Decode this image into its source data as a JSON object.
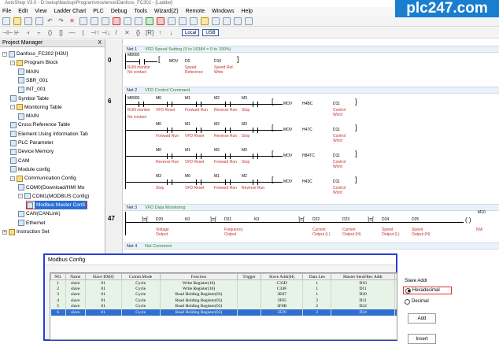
{
  "window": {
    "title": "AutoShop V3.0 - D:\\setup\\backup\\Program\\movience\\Danfoss_FC302 - [Ladder]"
  },
  "watermark": "plc247.com",
  "menu": [
    "File",
    "Edit",
    "View",
    "Ladder Chart",
    "PLC",
    "Debug",
    "Tools",
    "Wizard(Z)",
    "Remote",
    "Windows",
    "Help"
  ],
  "toolbar": {
    "local": "Local",
    "usb": "USB"
  },
  "project": {
    "header": "Project Manager",
    "close": "X",
    "pin": "❒",
    "items": [
      {
        "label": "Danfoss_FC302 [H3U]",
        "indent": 0,
        "box": "-",
        "icon": "plc-icon"
      },
      {
        "label": "Program Block",
        "indent": 1,
        "box": "-",
        "icon": "folder-icon"
      },
      {
        "label": "MAIN",
        "indent": 2,
        "box": "",
        "icon": "program-icon"
      },
      {
        "label": "SBR_001",
        "indent": 2,
        "box": "",
        "icon": "program-icon"
      },
      {
        "label": "INT_001",
        "indent": 2,
        "box": "",
        "icon": "program-icon"
      },
      {
        "label": "Symbol Table",
        "indent": 1,
        "box": "",
        "icon": "table-icon"
      },
      {
        "label": "Monitoring Table",
        "indent": 1,
        "box": "-",
        "icon": "folder-icon"
      },
      {
        "label": "MAIN",
        "indent": 2,
        "box": "",
        "icon": "table-icon"
      },
      {
        "label": "Cross Reference Table",
        "indent": 1,
        "box": "",
        "icon": "table-icon"
      },
      {
        "label": "Element Using Information Tab",
        "indent": 1,
        "box": "",
        "icon": "table-icon"
      },
      {
        "label": "PLC Parameter",
        "indent": 1,
        "box": "",
        "icon": "gear-icon"
      },
      {
        "label": "Device Memory",
        "indent": 1,
        "box": "",
        "icon": "memory-icon"
      },
      {
        "label": "CAM",
        "indent": 1,
        "box": "",
        "icon": "cam-icon"
      },
      {
        "label": "Module config",
        "indent": 1,
        "box": "",
        "icon": "module-icon"
      },
      {
        "label": "Communication Config",
        "indent": 1,
        "box": "-",
        "icon": "folder-icon"
      },
      {
        "label": "COM0(Download/HMI Mo",
        "indent": 2,
        "box": "",
        "icon": "port-icon"
      },
      {
        "label": "COM1(MODBUS Config)",
        "indent": 2,
        "box": "-",
        "icon": "port-icon"
      },
      {
        "label": "Modbus Master Confi",
        "indent": 3,
        "box": "",
        "icon": "modbus-icon",
        "selected": true
      },
      {
        "label": "CAN(CANLink)",
        "indent": 2,
        "box": "",
        "icon": "port-icon"
      },
      {
        "label": "Ethernet",
        "indent": 2,
        "box": "",
        "icon": "port-icon"
      },
      {
        "label": "Instruction Set",
        "indent": 0,
        "box": "+",
        "icon": "folder-icon"
      }
    ]
  },
  "ladder": {
    "net1": {
      "title": "Net 1",
      "comment": "VFD Speed Setting (0 to 16384 = 0 to 100%)",
      "rung": "0",
      "contact": "M8000",
      "contact_c1": "RUN monitor",
      "contact_c2": "No contact",
      "instr": "MOV",
      "op1": "D0",
      "op2": "D10",
      "op1_c1": "Speed",
      "op1_c2": "Reference",
      "op2_c1": "Speed Ref.",
      "op2_c2": "Write"
    },
    "net2": {
      "title": "Net 2",
      "comment": "VFD Control Command",
      "rung": "6",
      "rows": [
        {
          "c": [
            "M8000",
            "M0",
            "M1",
            "M2",
            "M3"
          ],
          "cm": [
            "RUN monitor",
            "VFD Reset",
            "Forward Run",
            "Reverse Run",
            "Stop"
          ],
          "cm2": "No contact",
          "src": "H4BC",
          "dst": "D11",
          "dc1": "Control",
          "dc2": "Word"
        },
        {
          "c": [
            "",
            "M0",
            "M1",
            "M2",
            "M3"
          ],
          "cm": [
            "",
            "Forward Run",
            "VFD Reset",
            "Reverse Run",
            "Stop"
          ],
          "src": "H47C",
          "dst": "D11",
          "dc1": "Control",
          "dc2": "Word"
        },
        {
          "c": [
            "",
            "M0",
            "M1",
            "M2",
            "M3"
          ],
          "cm": [
            "",
            "Reverse Run",
            "VFD Reset",
            "Forward Run",
            "Stop"
          ],
          "src": "H84TC",
          "dst": "D11",
          "dc1": "Control",
          "dc2": "Word"
        },
        {
          "c": [
            "",
            "M3",
            "M0",
            "M1",
            "M2"
          ],
          "cm": [
            "",
            "Stop",
            "VFD Reset",
            "Forward Run",
            "Reverse Run"
          ],
          "src": "H43C",
          "dst": "D11",
          "dc1": "Control",
          "dc2": "Word"
        }
      ],
      "instr": "MOV"
    },
    "net3": {
      "title": "Net 3",
      "comment": "VFD Data Monitoring",
      "rung": "47",
      "items": [
        {
          "l": "D20",
          "c1": "Voltage",
          "c2": "Output"
        },
        {
          "l": "K0",
          "c1": "",
          "c2": ""
        },
        {
          "l": "D21",
          "c1": "Frequency",
          "c2": "Output"
        },
        {
          "l": "K0",
          "c1": "",
          "c2": ""
        },
        {
          "l": "D22",
          "c1": "Current",
          "c2": "Output (L)"
        },
        {
          "l": "D23",
          "c1": "Current",
          "c2": "Output (H)"
        },
        {
          "l": "D24",
          "c1": "Speed",
          "c2": "Output (L)"
        },
        {
          "l": "D25",
          "c1": "Speed",
          "c2": "Output (H)"
        }
      ],
      "coil": "M10",
      "coil_c": "N/A"
    },
    "net4": {
      "title": "Net 4",
      "comment": "Net Comment"
    }
  },
  "modbus": {
    "title": "Modbus Config",
    "columns": [
      "NO.",
      "Name",
      "Slave ID(H)",
      "Comm.Mode",
      "Function",
      "Trigger",
      "Slave Addr(H)",
      "Data Len",
      "Master Send/Rec Addr",
      "Repe"
    ],
    "rows": [
      [
        "1",
        "slave",
        "01",
        "Cycle",
        "Write Register(16)",
        "",
        "C35D",
        "1",
        "D10",
        "3"
      ],
      [
        "2",
        "slave",
        "01",
        "Cycle",
        "Write Register(16)",
        "",
        "C34F",
        "1",
        "D11",
        "3"
      ],
      [
        "3",
        "slave",
        "01",
        "Cycle",
        "Read Holding Register(03)",
        "",
        "3E87",
        "1",
        "D20",
        "3"
      ],
      [
        "4",
        "slave",
        "01",
        "Cycle",
        "Read Holding Register(03)",
        "",
        "3F05",
        "2",
        "D21",
        "3"
      ],
      [
        "5",
        "slave",
        "01",
        "Cycle",
        "Read Holding Register(03)",
        "",
        "3F0B",
        "2",
        "D22",
        "3"
      ],
      [
        "6",
        "slave",
        "01",
        "Cycle",
        "Read Holding Register(03)",
        "",
        "3F29",
        "2",
        "D24",
        "3"
      ]
    ],
    "selected_row": 5,
    "slave_addr_label": "Slave Addr",
    "hex_label": "Hexadecimal",
    "dec_label": "Decimal",
    "add_label": "Add",
    "insert_label": "Insert"
  }
}
